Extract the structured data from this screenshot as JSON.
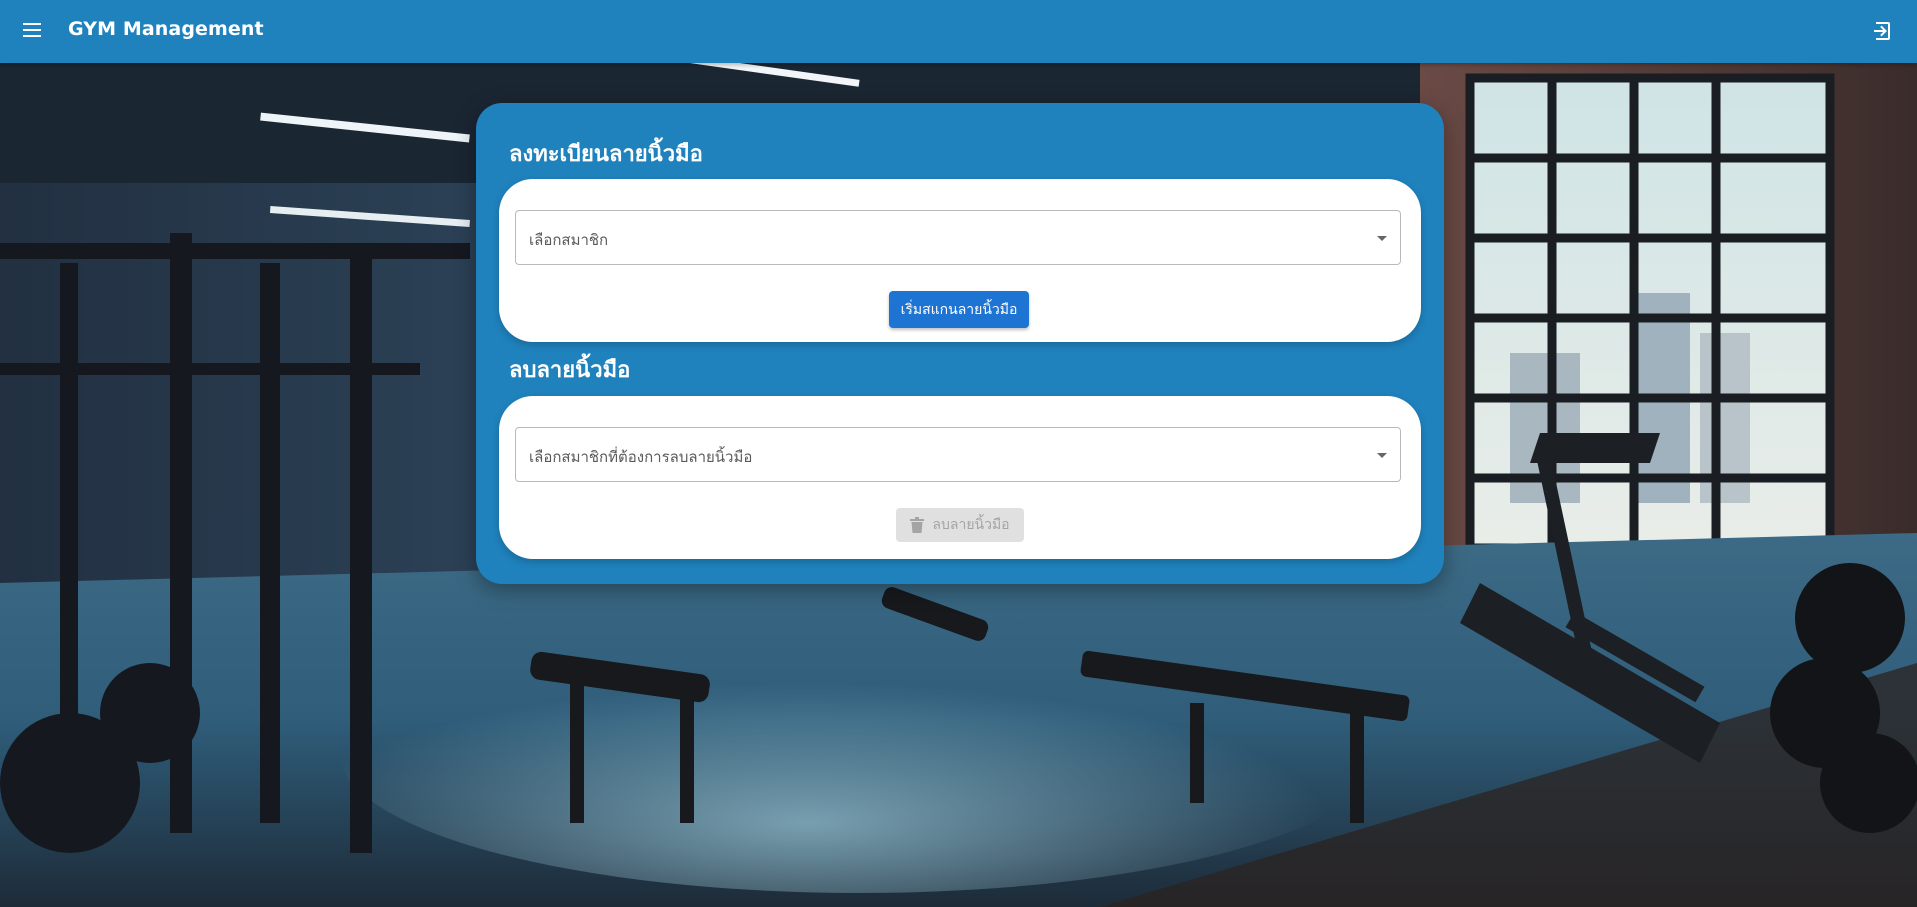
{
  "app": {
    "title": "GYM Management",
    "menu_icon": "menu-icon",
    "logout_icon": "logout-icon",
    "primary_color": "#1f82bd"
  },
  "register": {
    "title": "ลงทะเบียนลายนิ้วมือ",
    "select_placeholder": "เลือกสมาชิก",
    "scan_button_label": "เริ่มสแกนลายนิ้วมือ",
    "button_color": "#1e74d2"
  },
  "delete": {
    "title": "ลบลายนิ้วมือ",
    "select_placeholder": "เลือกสมาชิกที่ต้องการลบลายนิ้วมือ",
    "delete_button_label": "ลบลายนิ้วมือ",
    "delete_button_icon": "trash-icon",
    "delete_button_disabled": true
  }
}
